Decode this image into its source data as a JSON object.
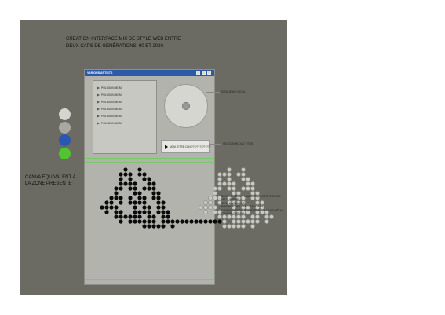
{
  "heading": {
    "line1": "CREATION INTERFACE MIX DE STYLE WEB ENTRE",
    "line2": "DEUX CAPS DE GÉNÉRATIONS, 90 ET 2020."
  },
  "palette": [
    "#d4d4d0",
    "#a8a8a3",
    "#2a57b0",
    "#52c430"
  ],
  "window": {
    "title": "VARIOUS ARTISTS",
    "buttons": [
      "minimize-icon",
      "maximize-icon",
      "close-icon"
    ],
    "tracks": [
      "POLYGON MOM",
      "POLYGON MOM",
      "POLYGON MOM",
      "POLYGON MOM",
      "POLYGON MOM",
      "POLYGON MOM"
    ],
    "now_playing": "MOM, TITRE CON ??????????????"
  },
  "annotations": {
    "cover": "DISQUE AU VOCAL",
    "lecture": "SELECTION DUO TITRE",
    "canva_line1": "CANVA EQUIVALENT À",
    "canva_line2": "LA ZONE PRESENTE",
    "pixel_1": "DEVRAIT PIXEL + ANIMATION, INTERFERENCE DU CURSEUR",
    "pixel_2": "DE CHANGEMENT,",
    "pixel_3": "POSITION DES CERCLES + ALEA,",
    "pixel_4": "CHANGEMENTS DE POSITION COULEUR MÉTAL,",
    "pixel_5": "CHANGE DES ???"
  }
}
